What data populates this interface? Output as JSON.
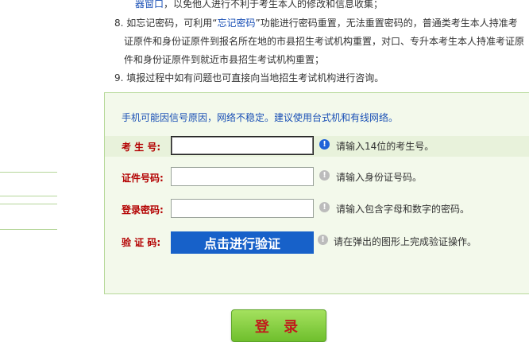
{
  "notes": {
    "line0_link": "器窗口",
    "line0_rest": "，以免他人进行不利于考生本人的修改和信息收集；",
    "line8_a": "8. 如忘记密码，可利用“",
    "line8_link": "忘记密码",
    "line8_b": "”功能进行密码重置，无法重置密码的，普通类考生本人持准考",
    "line8_c": "证原件和身份证原件到报名所在地的市县招生考试机构重置，对口、专升本考生本人持准考证原",
    "line8_d": "件和身份证原件到就近市县招生考试机构重置；",
    "line9": "9. 填报过程中如有问题也可直接向当地招生考试机构进行咨询。"
  },
  "form": {
    "hint": "手机可能因信号原因，网络不稳定。建议使用台式机和有线网络。",
    "exam_no": {
      "label": "考 生 号:",
      "value": "",
      "tip": "请输入14位的考生号。"
    },
    "id_no": {
      "label": "证件号码:",
      "value": "",
      "tip": "请输入身份证号码。"
    },
    "password": {
      "label": "登录密码:",
      "value": "",
      "tip": "请输入包含字母和数字的密码。"
    },
    "verify": {
      "label": "验 证 码:",
      "button": "点击进行验证",
      "tip": "请在弹出的图形上完成验证操作。"
    }
  },
  "login_button": "登 录",
  "colors": {
    "accent_blue": "#1761c9",
    "label_red": "#b30000",
    "panel_bg": "#f3f9eb",
    "login_green": "#8fd149"
  }
}
